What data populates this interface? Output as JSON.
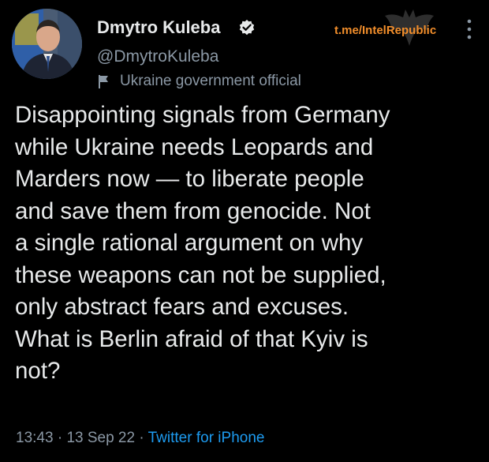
{
  "tweet": {
    "author": {
      "display_name": "Dmytro Kuleba",
      "handle": "@DmytroKuleba",
      "label": "Ukraine government official",
      "verified_icon": "verified-badge-icon",
      "label_icon": "flag-icon"
    },
    "watermark": "t.me/IntelRepublic",
    "text": "Disappointing signals from Germany\nwhile Ukraine needs Leopards and\nMarders now — to liberate people\nand save them from genocide. Not\na single rational argument on why\nthese weapons can not be supplied,\nonly abstract fears and excuses.\nWhat is Berlin afraid of that Kyiv is\nnot?",
    "time": "13:43",
    "separator": "·",
    "date": "13 Sep 22",
    "source": "Twitter for iPhone"
  },
  "colors": {
    "background": "#000000",
    "text_primary": "#e7e9ea",
    "text_secondary": "#8b98a5",
    "link": "#1d9bf0",
    "watermark": "#f28e2b"
  }
}
